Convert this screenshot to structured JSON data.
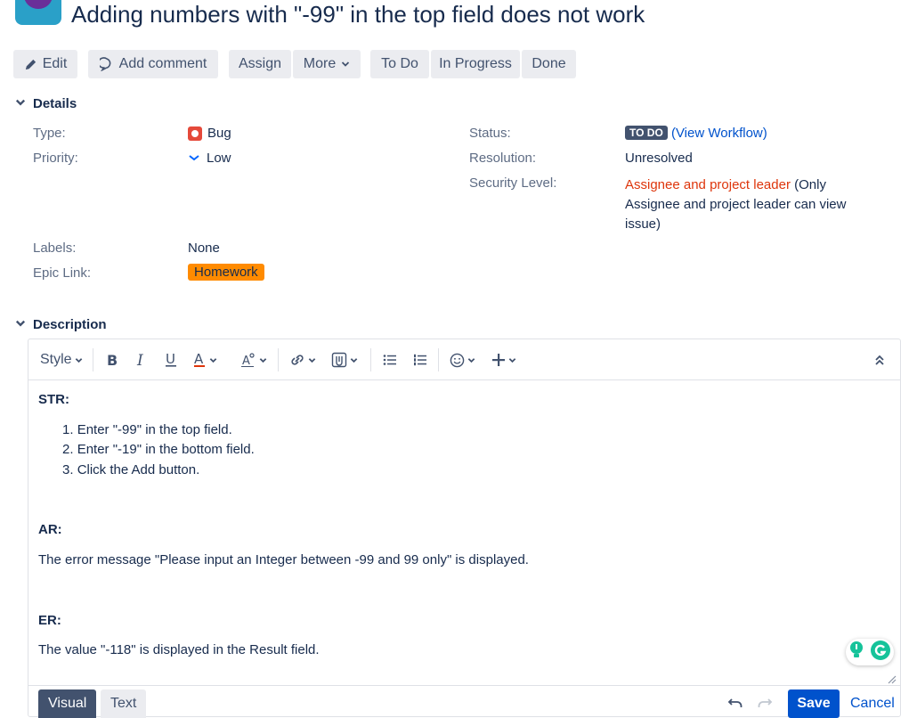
{
  "issue": {
    "title": "Adding numbers with \"-99\" in the top field does not work"
  },
  "toolbar": {
    "edit": "Edit",
    "add_comment": "Add comment",
    "assign": "Assign",
    "more": "More",
    "todo": "To Do",
    "in_progress": "In Progress",
    "done": "Done"
  },
  "details": {
    "heading": "Details",
    "type_label": "Type:",
    "type_value": "Bug",
    "priority_label": "Priority:",
    "priority_value": "Low",
    "labels_label": "Labels:",
    "labels_value": "None",
    "epic_label": "Epic Link:",
    "epic_value": "Homework",
    "status_label": "Status:",
    "status_value": "TO DO",
    "view_workflow": "(View Workflow)",
    "resolution_label": "Resolution:",
    "resolution_value": "Unresolved",
    "security_label": "Security Level:",
    "security_value": "Assignee and project leader",
    "security_note_1": "(Only",
    "security_note_2": "Assignee and project leader can view",
    "security_note_3": "issue)"
  },
  "description": {
    "heading": "Description",
    "editor_toolbar": {
      "style": "Style"
    },
    "content": {
      "str_heading": "STR:",
      "steps": [
        "Enter \"-99\" in the top field.",
        "Enter \"-19\" in the bottom field.",
        "Click the Add button."
      ],
      "ar_heading": "AR:",
      "ar_text": "The error message \"Please input an Integer between -99 and 99 only\" is displayed.",
      "er_heading": "ER:",
      "er_text": "The value \"-118\" is displayed in the Result field."
    },
    "footer": {
      "visual": "Visual",
      "text": "Text",
      "save": "Save",
      "cancel": "Cancel"
    }
  },
  "colors": {
    "accent": "#0052cc",
    "bug": "#e5493a",
    "epic": "#ff8b00",
    "security": "#de350b",
    "status_lozenge": "#42526e"
  }
}
